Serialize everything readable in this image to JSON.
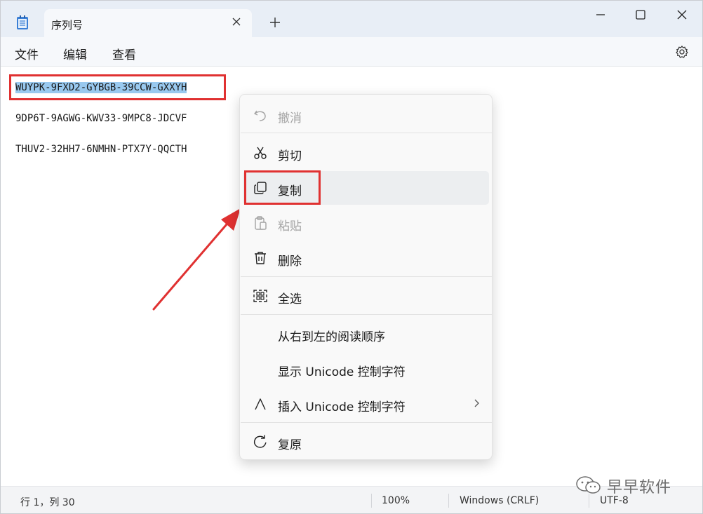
{
  "app": {
    "tab_title": "序列号",
    "menu": {
      "file": "文件",
      "edit": "编辑",
      "view": "查看"
    }
  },
  "editor": {
    "lines": [
      "WUYPK-9FXD2-GYBGB-39CCW-GXXYH",
      "9DP6T-9AGWG-KWV33-9MPC8-JDCVF",
      "THUV2-32HH7-6NMHN-PTX7Y-QQCTH"
    ]
  },
  "context_menu": {
    "items": [
      {
        "label": "撤消",
        "icon": "undo-icon",
        "enabled": false
      },
      {
        "label": "剪切",
        "icon": "scissors-icon",
        "enabled": true
      },
      {
        "label": "复制",
        "icon": "copy-icon",
        "enabled": true,
        "hovered": true
      },
      {
        "label": "粘贴",
        "icon": "clipboard-icon",
        "enabled": false
      },
      {
        "label": "删除",
        "icon": "trash-icon",
        "enabled": true
      },
      {
        "label": "全选",
        "icon": "select-all-icon",
        "enabled": true
      },
      {
        "label": "从右到左的阅读顺序",
        "icon": "",
        "enabled": true
      },
      {
        "label": "显示 Unicode 控制字符",
        "icon": "",
        "enabled": true
      },
      {
        "label": "插入 Unicode 控制字符",
        "icon": "unicode-caret-icon",
        "enabled": true,
        "submenu": true
      },
      {
        "label": "复原",
        "icon": "reconvert-icon",
        "enabled": true
      }
    ]
  },
  "status": {
    "position": "行 1，列 30",
    "zoom": "100%",
    "line_ending": "Windows (CRLF)",
    "encoding": "UTF-8"
  },
  "watermark": {
    "text": "早早软件"
  },
  "colors": {
    "annotation_red": "#e03131",
    "selection": "#99c9ef",
    "titlebar": "#e8eef6"
  }
}
